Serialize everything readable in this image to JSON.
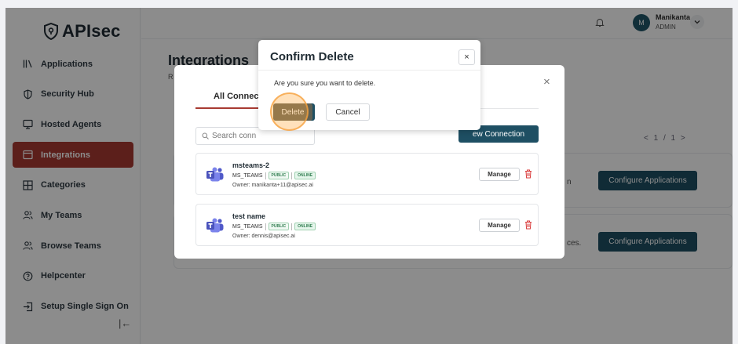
{
  "brand": {
    "name": "APIsec"
  },
  "sidebar": {
    "items": [
      {
        "label": "Applications",
        "icon": "library-icon",
        "active": false
      },
      {
        "label": "Security Hub",
        "icon": "shield-icon",
        "active": false
      },
      {
        "label": "Hosted Agents",
        "icon": "monitor-icon",
        "active": false
      },
      {
        "label": "Integrations",
        "icon": "window-icon",
        "active": true
      },
      {
        "label": "Categories",
        "icon": "grid-icon",
        "active": false
      },
      {
        "label": "My Teams",
        "icon": "users-icon",
        "active": false
      },
      {
        "label": "Browse Teams",
        "icon": "users-icon",
        "active": false
      },
      {
        "label": "Helpcenter",
        "icon": "help-icon",
        "active": false
      },
      {
        "label": "Setup Single Sign On",
        "icon": "login-icon",
        "active": false
      }
    ],
    "collapse_glyph": "|←"
  },
  "header": {
    "user_initial": "M",
    "user_name": "Manikanta",
    "user_role": "ADMIN"
  },
  "page": {
    "title": "Integrations",
    "subtitle_fragment": "R",
    "pager": "< 1 / 1 >",
    "cards": [
      {
        "fragment": "n",
        "button": "Configure Applications"
      },
      {
        "fragment": "ces.",
        "button": "Configure Applications"
      }
    ]
  },
  "connections_modal": {
    "close_glyph": "×",
    "tab_label": "All Connect",
    "search_placeholder": "Search conn",
    "new_connection_label": "ew Connection",
    "rows": [
      {
        "name": "msteams-2",
        "type": "MS_TEAMS",
        "visibility": "PUBLIC",
        "status": "ONLINE",
        "owner": "Owner: manikanta+11@apisec.ai",
        "manage": "Manage"
      },
      {
        "name": "test name",
        "type": "MS_TEAMS",
        "visibility": "PUBLIC",
        "status": "ONLINE",
        "owner": "Owner: dennis@apisec.ai",
        "manage": "Manage"
      }
    ]
  },
  "confirm_dialog": {
    "title": "Confirm Delete",
    "close_glyph": "×",
    "message": "Are you sure you want to delete.",
    "delete_label": "Delete",
    "cancel_label": "Cancel"
  },
  "colors": {
    "accent": "#a83a32",
    "primary": "#1e4f63",
    "delete_button": "#5e6054"
  }
}
